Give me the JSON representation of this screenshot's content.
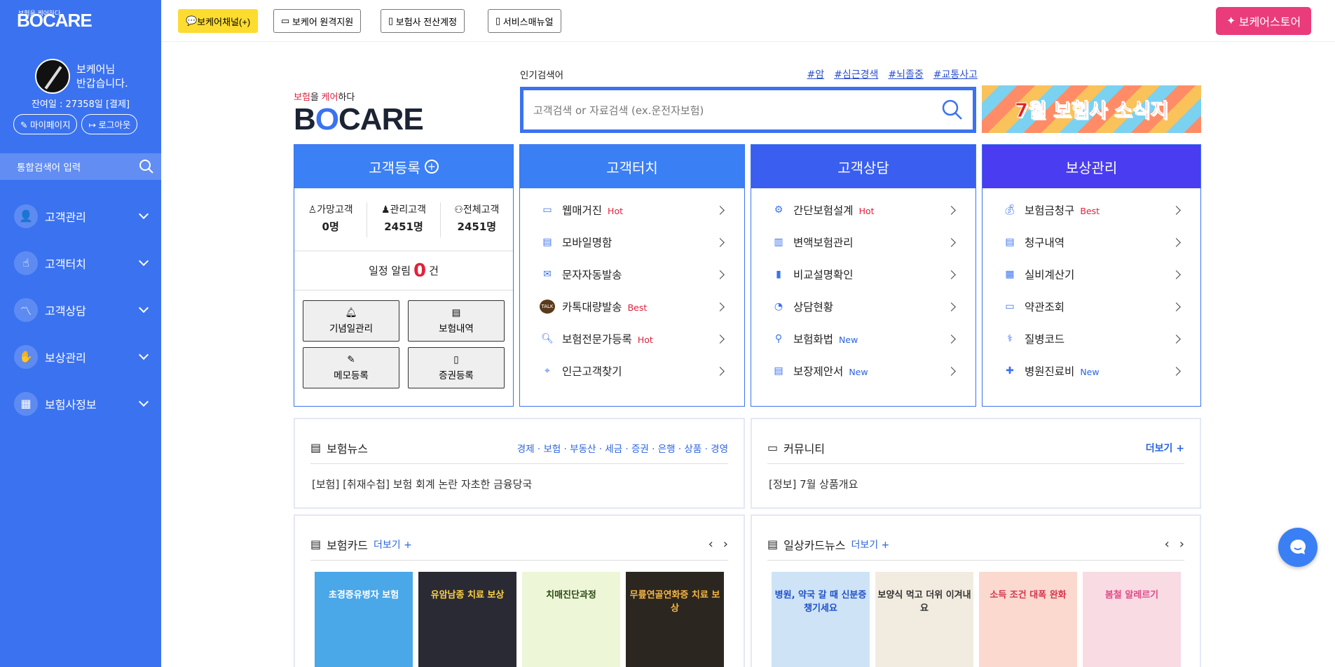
{
  "sidebar": {
    "logo_tag": "보험을 케어하다",
    "logo": "BOCARE",
    "greet1": "보케어님",
    "greet2": "반갑습니다.",
    "balance": "잔여일 : 27358일 [결제]",
    "mypage": "마이페이지",
    "logout": "로그아웃",
    "search_placeholder": "통합검색어 입력",
    "menu": [
      {
        "label": "고객관리",
        "icon": "person-icon"
      },
      {
        "label": "고객터치",
        "icon": "hand-touch-icon"
      },
      {
        "label": "고객상담",
        "icon": "chart-line-icon"
      },
      {
        "label": "보상관리",
        "icon": "hands-icon"
      },
      {
        "label": "보험사정보",
        "icon": "building-icon"
      }
    ]
  },
  "topbar": {
    "kakao": "보케어채널(+)",
    "remote": "보케어 원격지원",
    "account": "보험사 전산계정",
    "manual": "서비스매뉴얼",
    "store": "보케어스토어"
  },
  "brand": {
    "tag_a": "보험",
    "tag_b": "을 ",
    "tag_c": "케어",
    "tag_d": "하다",
    "word_a": "B",
    "word_b": "O",
    "word_c": "CARE"
  },
  "search": {
    "popular_label": "인기검색어",
    "tags": [
      "#암",
      "#심근경색",
      "#뇌졸중",
      "#교통사고"
    ],
    "placeholder": "고객검색 or 자료검색 (ex.운전자보험)"
  },
  "banner": {
    "text": "7월 보험사 소식지"
  },
  "register": {
    "title": "고객등록",
    "stats": [
      {
        "label": "가망고객",
        "value": "0명"
      },
      {
        "label": "관리고객",
        "value": "2451명"
      },
      {
        "label": "전체고객",
        "value": "2451명"
      }
    ],
    "alarm_label": "일정 알림",
    "alarm_count": "0",
    "alarm_unit": "건",
    "buttons": [
      "기념일관리",
      "보험내역",
      "메모등록",
      "증권등록"
    ]
  },
  "touch": {
    "title": "고객터치",
    "items": [
      {
        "label": "웹매거진",
        "badge": "Hot"
      },
      {
        "label": "모바일명함",
        "badge": ""
      },
      {
        "label": "문자자동발송",
        "badge": ""
      },
      {
        "label": "카톡대량발송",
        "badge": "Best"
      },
      {
        "label": "보험전문가등록",
        "badge": "Hot"
      },
      {
        "label": "인근고객찾기",
        "badge": ""
      }
    ]
  },
  "consult": {
    "title": "고객상담",
    "items": [
      {
        "label": "간단보험설계",
        "badge": "Hot"
      },
      {
        "label": "변액보험관리",
        "badge": ""
      },
      {
        "label": "비교설명확인",
        "badge": ""
      },
      {
        "label": "상담현황",
        "badge": ""
      },
      {
        "label": "보험화법",
        "badge": "New"
      },
      {
        "label": "보장제안서",
        "badge": "New"
      }
    ]
  },
  "claims": {
    "title": "보상관리",
    "items": [
      {
        "label": "보험금청구",
        "badge": "Best"
      },
      {
        "label": "청구내역",
        "badge": ""
      },
      {
        "label": "실비계산기",
        "badge": ""
      },
      {
        "label": "약관조회",
        "badge": ""
      },
      {
        "label": "질병코드",
        "badge": ""
      },
      {
        "label": "병원진료비",
        "badge": "New"
      }
    ]
  },
  "news": {
    "title": "보험뉴스",
    "categories": "경제 · 보험 · 부동산 · 세금 · 증권 · 은행 · 상품 · 경영",
    "headline": "[보험] [취재수첩] 보험 회계 논란 자초한 금융당국"
  },
  "community": {
    "title": "커뮤니티",
    "more": "더보기 +",
    "headline": "[정보] 7월 상품개요"
  },
  "ins_card": {
    "title": "보험카드",
    "more": "더보기 +",
    "thumbs": [
      "초경증유병자 보험",
      "유암남종 치료 보상",
      "치매진단과정",
      "무릎연골연화증 치료 보상"
    ]
  },
  "daily_card": {
    "title": "일상카드뉴스",
    "more": "더보기 +",
    "thumbs": [
      "병원, 약국 갈 때 신분증 챙기세요",
      "보양식 먹고 더위 이겨내요",
      "소득 조건 대폭 완화",
      "봄철 알레르기"
    ]
  },
  "colors": {
    "primary": "#3b72f0",
    "accent": "#ea3c7a",
    "kakao": "#fddc30",
    "hot": "#e2213b"
  }
}
